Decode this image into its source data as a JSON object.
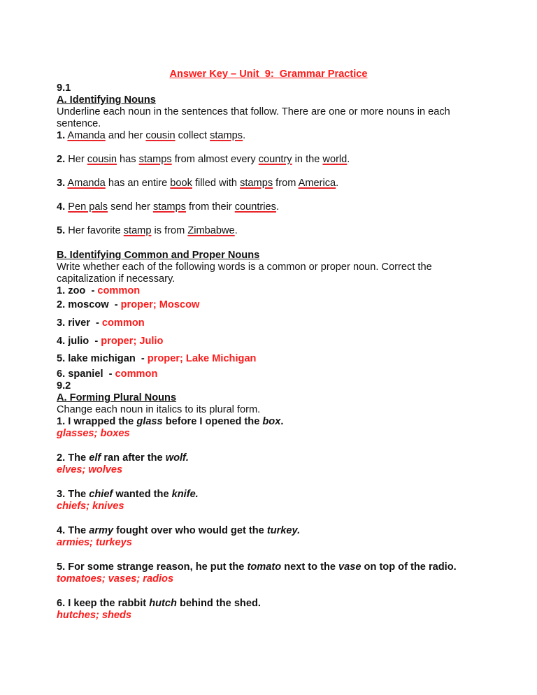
{
  "title": "Answer Key – Unit  9:  Grammar Practice",
  "section_91": {
    "number": "9.1",
    "part_a": {
      "heading": "A. Identifying Nouns",
      "instructions_line1": "Underline each noun in the sentences that follow. There are one or more nouns in each",
      "instructions_line2": "sentence.",
      "items": [
        {
          "num": "1.",
          "segments": [
            {
              "t": " ",
              "noun": false
            },
            {
              "t": "Amanda",
              "noun": true
            },
            {
              "t": " and her ",
              "noun": false
            },
            {
              "t": "cousin",
              "noun": true
            },
            {
              "t": " collect ",
              "noun": false
            },
            {
              "t": "stamps",
              "noun": true
            },
            {
              "t": ".",
              "noun": false
            }
          ]
        },
        {
          "num": "2.",
          "segments": [
            {
              "t": " Her ",
              "noun": false
            },
            {
              "t": "cousin",
              "noun": true
            },
            {
              "t": " has ",
              "noun": false
            },
            {
              "t": "stamps",
              "noun": true
            },
            {
              "t": " from almost every ",
              "noun": false
            },
            {
              "t": "country",
              "noun": true
            },
            {
              "t": " in the ",
              "noun": false
            },
            {
              "t": "world",
              "noun": true
            },
            {
              "t": ".",
              "noun": false
            }
          ]
        },
        {
          "num": "3.",
          "segments": [
            {
              "t": " ",
              "noun": false
            },
            {
              "t": "Amanda",
              "noun": true
            },
            {
              "t": " has an entire ",
              "noun": false
            },
            {
              "t": "book",
              "noun": true
            },
            {
              "t": " filled with ",
              "noun": false
            },
            {
              "t": "stamps",
              "noun": true
            },
            {
              "t": " from ",
              "noun": false
            },
            {
              "t": "America",
              "noun": true
            },
            {
              "t": ".",
              "noun": false
            }
          ]
        },
        {
          "num": "4.",
          "segments": [
            {
              "t": " ",
              "noun": false
            },
            {
              "t": "Pen pals",
              "noun": true
            },
            {
              "t": " send her ",
              "noun": false
            },
            {
              "t": "stamps",
              "noun": true
            },
            {
              "t": " from their ",
              "noun": false
            },
            {
              "t": "countries",
              "noun": true
            },
            {
              "t": ".",
              "noun": false
            }
          ]
        },
        {
          "num": "5.",
          "segments": [
            {
              "t": " Her favorite ",
              "noun": false
            },
            {
              "t": "stamp",
              "noun": true
            },
            {
              "t": " is from ",
              "noun": false
            },
            {
              "t": "Zimbabwe",
              "noun": true
            },
            {
              "t": ".",
              "noun": false
            }
          ]
        }
      ]
    },
    "part_b": {
      "heading": "B. Identifying Common and Proper Nouns",
      "instructions_line1": "Write whether each of the following words is a common or proper noun. Correct the",
      "instructions_line2": "capitalization if necessary.",
      "items": [
        {
          "q": "1. zoo  - ",
          "a": "common"
        },
        {
          "q": "2. moscow  - ",
          "a": "proper; Moscow"
        },
        {
          "q": "3. river  - ",
          "a": "common"
        },
        {
          "q": "4. julio  - ",
          "a": "proper; Julio"
        },
        {
          "q": "5. lake michigan  - ",
          "a": "proper; Lake Michigan"
        },
        {
          "q": "6. spaniel  - ",
          "a": "common"
        }
      ]
    }
  },
  "section_92": {
    "number": "9.2",
    "part_a": {
      "heading": "A. Forming Plural Nouns",
      "instructions": "Change each noun in italics to its plural form.",
      "items": [
        {
          "segments": [
            {
              "t": "1. I wrapped the ",
              "i": false
            },
            {
              "t": "glass",
              "i": true
            },
            {
              "t": " before I opened the ",
              "i": false
            },
            {
              "t": "box",
              "i": true
            },
            {
              "t": ".",
              "i": false
            }
          ],
          "answer": "glasses; boxes"
        },
        {
          "segments": [
            {
              "t": "2. The ",
              "i": false
            },
            {
              "t": "elf",
              "i": true
            },
            {
              "t": " ran after the ",
              "i": false
            },
            {
              "t": "wolf.",
              "i": true
            }
          ],
          "answer": "elves; wolves"
        },
        {
          "segments": [
            {
              "t": "3. The ",
              "i": false
            },
            {
              "t": "chief",
              "i": true
            },
            {
              "t": " wanted the ",
              "i": false
            },
            {
              "t": "knife.",
              "i": true
            }
          ],
          "answer": "chiefs; knives"
        },
        {
          "segments": [
            {
              "t": "4. The ",
              "i": false
            },
            {
              "t": "army",
              "i": true
            },
            {
              "t": " fought over who would get the ",
              "i": false
            },
            {
              "t": "turkey.",
              "i": true
            }
          ],
          "answer": "armies; turkeys"
        },
        {
          "segments": [
            {
              "t": "5. For some strange reason, he put the ",
              "i": false
            },
            {
              "t": "tomato",
              "i": true
            },
            {
              "t": " next to the ",
              "i": false
            },
            {
              "t": "vase",
              "i": true
            },
            {
              "t": " on top of the radio.",
              "i": false
            }
          ],
          "answer": "tomatoes; vases; radios"
        },
        {
          "segments": [
            {
              "t": "6. I keep the rabbit ",
              "i": false
            },
            {
              "t": "hutch",
              "i": true
            },
            {
              "t": " behind the shed.",
              "i": false
            }
          ],
          "answer": "hutches; sheds"
        }
      ]
    }
  }
}
